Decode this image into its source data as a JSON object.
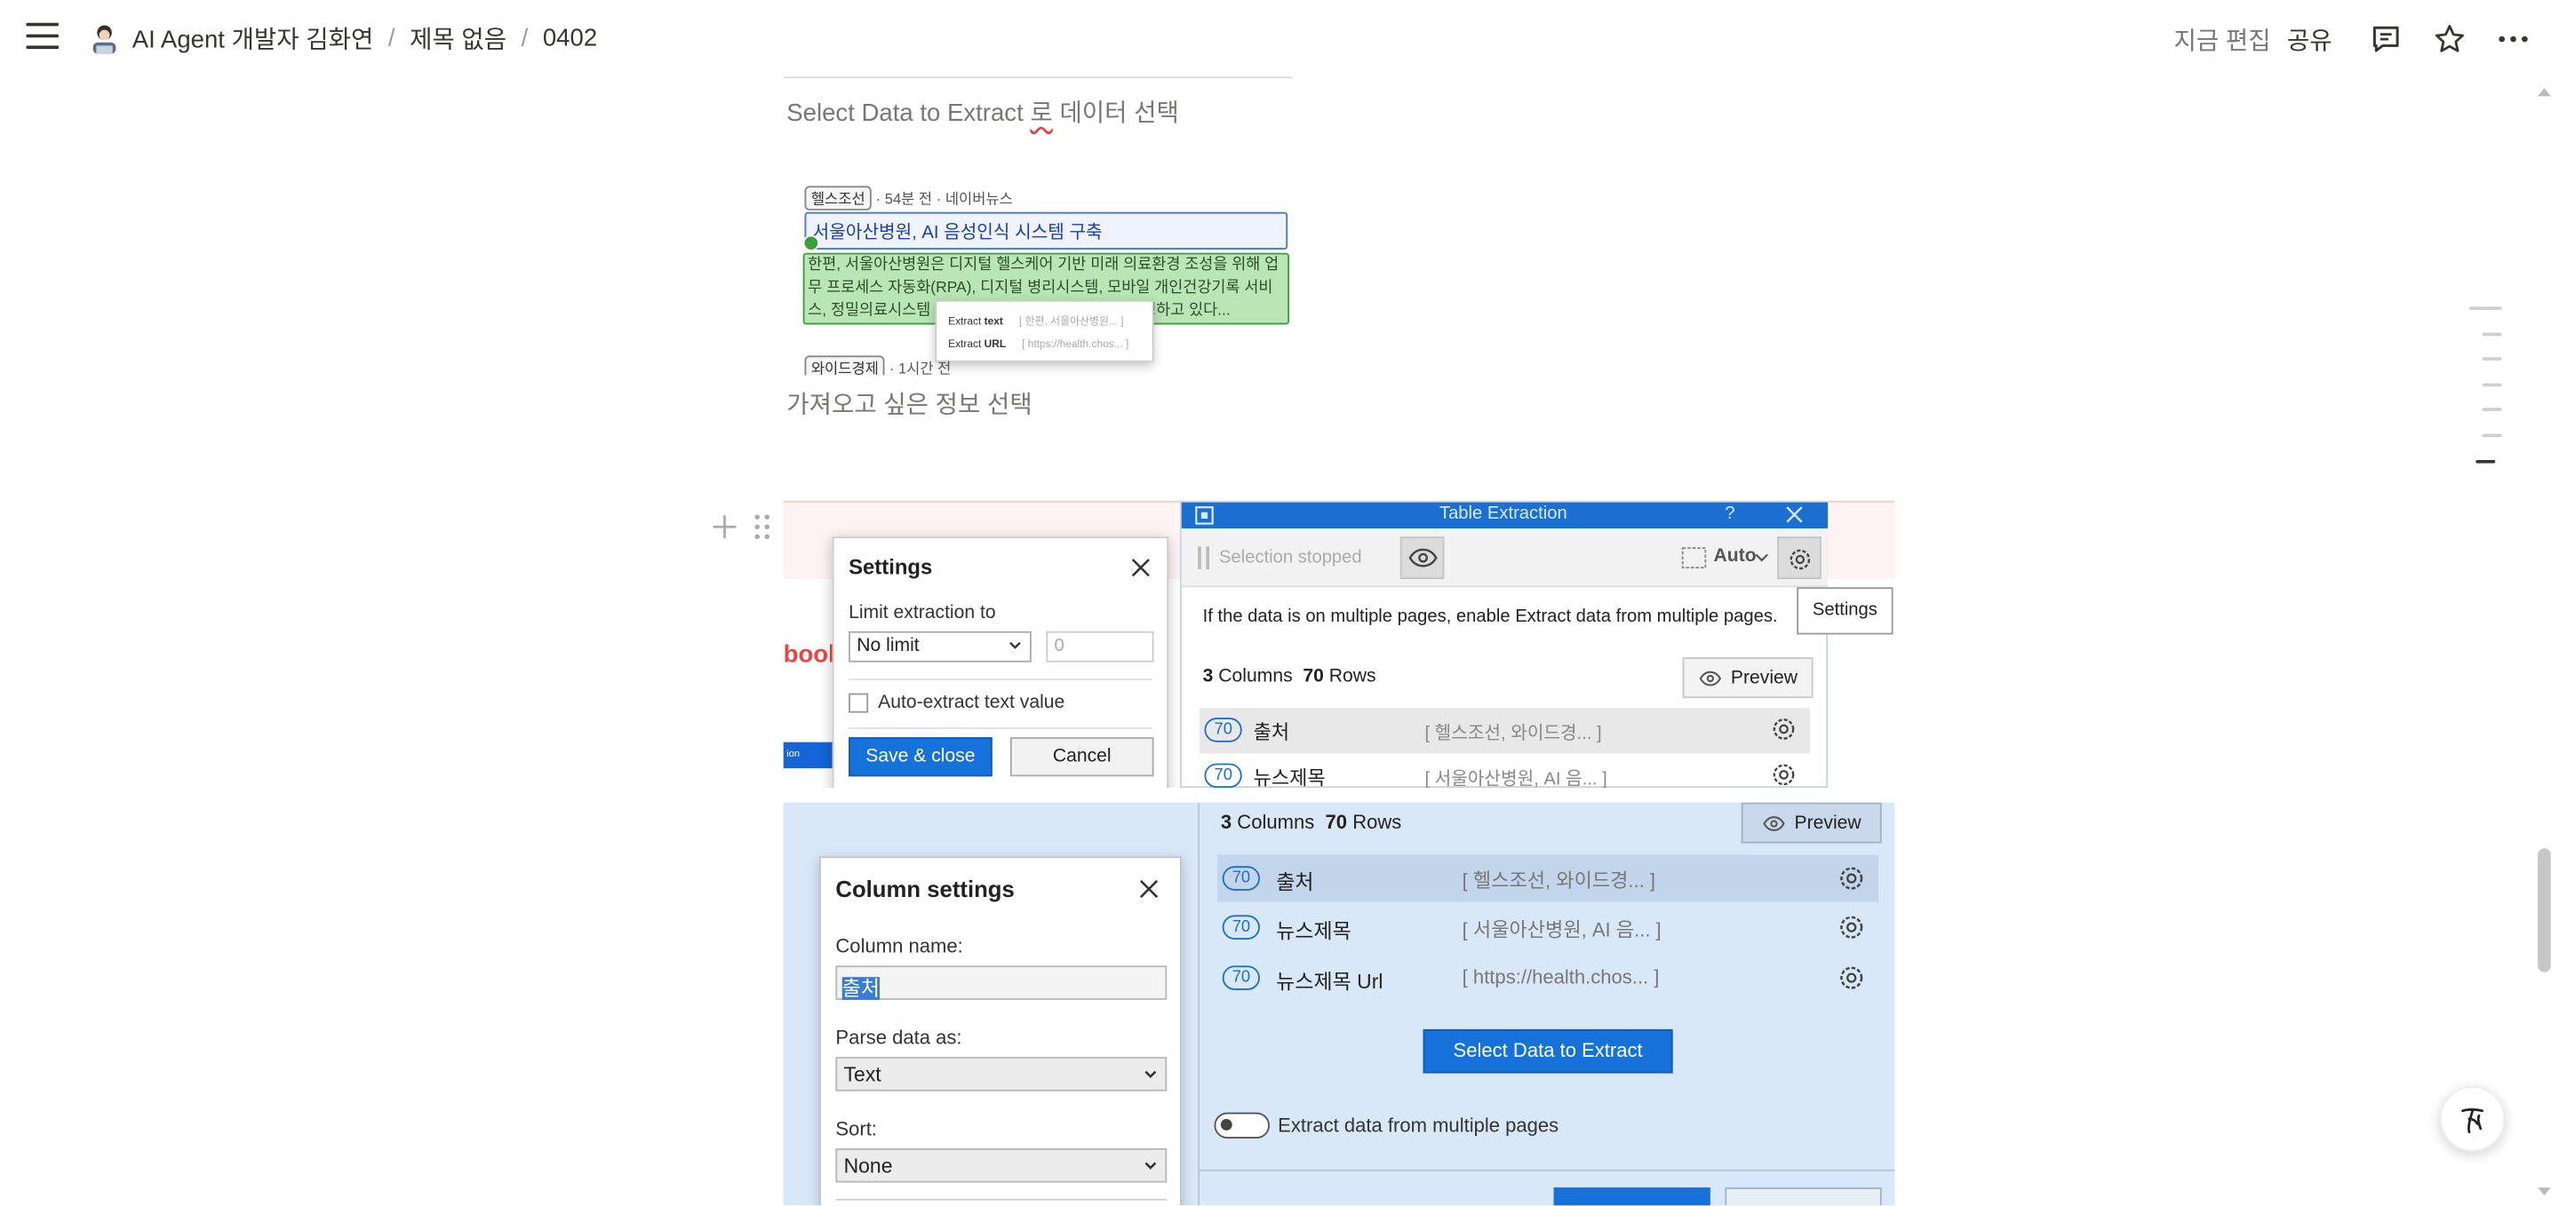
{
  "topbar": {
    "breadcrumb": [
      "AI Agent 개발자 김화연",
      "제목 없음",
      "0402"
    ],
    "separator": "/",
    "edited_label": "지금 편집",
    "share_label": "공유"
  },
  "doc": {
    "caption1": "Select Data to Extract",
    "caption1_suffix": " 데이터 선택",
    "caption1_squiggle": "로",
    "caption2": "가져오고 싶은 정보 선택"
  },
  "news_screenshot": {
    "item1_source": "헬스조선",
    "item1_meta": "· 54분 전 · 네이버뉴스",
    "item1_title": "서울아산병원, AI 음성인식 시스템 구축",
    "item1_body": "한편, 서울아산병원은 디지털 헬스케어 기반 미래 의료환경 조성을 위해 업무 프로세스 자동화(RPA), 디지털 병리시스템, 모바일 개인건강기록 서비스, 정밀의료시스템 등 다양한 디지털 혁신 사업을 시행하고 있다...",
    "item2_source": "와이드경제",
    "item2_meta": "· 1시간 전",
    "menu": [
      {
        "label_a": "Extract",
        "label_b": "text",
        "value": "[ 한편, 서울아산병원... ]"
      },
      {
        "label_a": "Extract",
        "label_b": "URL",
        "value": "[ https://health.chos... ]"
      }
    ]
  },
  "settings_dialog": {
    "title": "Settings",
    "limit_label": "Limit extraction to",
    "limit_value": "No limit",
    "limit_number": "0",
    "auto_extract_label": "Auto-extract text value",
    "save_label": "Save & close",
    "cancel_label": "Cancel",
    "page_fragment": "book",
    "blue_fragment": "ion"
  },
  "table_extraction": {
    "title": "Table Extraction",
    "help": "?",
    "status": "Selection stopped",
    "auto_label": "Auto",
    "tooltip": "Settings",
    "info": "If the data is on multiple pages, enable Extract data from multiple pages.",
    "columns_count": "3",
    "columns_label": "Columns",
    "rows_count": "70",
    "rows_label": "Rows",
    "preview_label": "Preview",
    "rows": [
      {
        "count": "70",
        "name": "출처",
        "value": "[ 헬스조선, 와이드경... ]"
      },
      {
        "count": "70",
        "name": "뉴스제목",
        "value": "[ 서울아산병원, AI 음... ]"
      }
    ]
  },
  "column_settings": {
    "title": "Column settings",
    "name_label": "Column name:",
    "name_value": "출처",
    "parse_label": "Parse data as:",
    "parse_value": "Text",
    "sort_label": "Sort:",
    "sort_value": "None",
    "columns_count": "3",
    "columns_label": "Columns",
    "rows_count": "70",
    "rows_label": "Rows",
    "preview_label": "Preview",
    "rows": [
      {
        "count": "70",
        "name": "출처",
        "value": "[ 헬스조선, 와이드경... ]"
      },
      {
        "count": "70",
        "name": "뉴스제목",
        "value": "[ 서울아산병원, AI 음... ]"
      },
      {
        "count": "70",
        "name": "뉴스제목 Url",
        "value": "[ https://health.chos... ]"
      }
    ],
    "select_button": "Select Data to Extract",
    "multi_page_label": "Extract data from multiple pages"
  },
  "colors": {
    "accent_blue": "#1672d8",
    "text_primary": "#37352f",
    "text_secondary": "#787774",
    "panel_bg": "#d9e8f8"
  }
}
